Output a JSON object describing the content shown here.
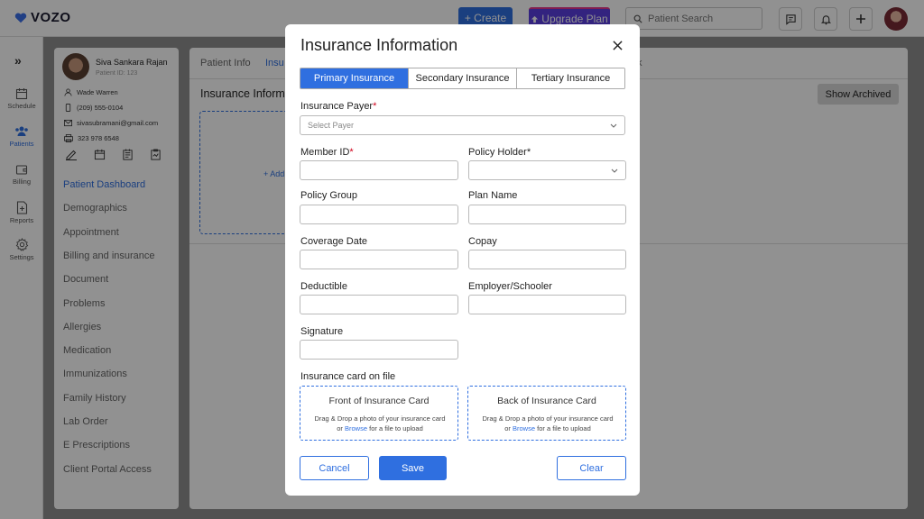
{
  "app": {
    "logo_text": "VOZO",
    "create_label": "+ Create",
    "upgrade_label": "Upgrade Plan",
    "search_placeholder": "Patient Search"
  },
  "nav": {
    "items": [
      {
        "label": "Schedule"
      },
      {
        "label": "Patients"
      },
      {
        "label": "Billing"
      },
      {
        "label": "Reports"
      },
      {
        "label": "Settings"
      }
    ]
  },
  "patient": {
    "name": "Siva Sankara Rajan",
    "id_label": "Patient ID:",
    "id_value": "123",
    "contact_name": "Wade Warren",
    "phone": "(209) 555-0104",
    "email": "sivasubramani@gmail.com",
    "fax": "323 978 6548"
  },
  "patient_menu": [
    "Patient Dashboard",
    "Demographics",
    "Appointment",
    "Billing and insurance",
    "Document",
    "Problems",
    "Allergies",
    "Medication",
    "Immunizations",
    "Family History",
    "Lab Order",
    "E Prescriptions",
    "Client Portal Access"
  ],
  "main": {
    "tabs": [
      "Patient Info",
      "Insu",
      "k"
    ],
    "heading": "Insurance Inform",
    "show_archived": "Show Archived",
    "add_card": "+ Add"
  },
  "modal": {
    "title": "Insurance Information",
    "tabs": [
      "Primary Insurance",
      "Secondary Insurance",
      "Tertiary Insurance"
    ],
    "active_tab": "Primary Insurance",
    "fields": {
      "insurance_payer": {
        "label": "Insurance Payer",
        "placeholder": "Select Payer"
      },
      "member_id": {
        "label": "Member ID",
        "value": ""
      },
      "policy_holder": {
        "label": "Policy Holder",
        "value": ""
      },
      "policy_group": {
        "label": "Policy Group",
        "value": ""
      },
      "plan_name": {
        "label": "Plan Name",
        "value": ""
      },
      "coverage_date": {
        "label": "Coverage Date",
        "value": ""
      },
      "copay": {
        "label": "Copay",
        "value": ""
      },
      "deductible": {
        "label": "Deductible",
        "value": ""
      },
      "employer": {
        "label": "Employer/Schooler",
        "value": ""
      },
      "signature": {
        "label": "Signature",
        "value": ""
      }
    },
    "required_mark": "*",
    "card_section_label": "Insurance card on file",
    "front_card": {
      "title": "Front of Insurance Card",
      "desc_before": "Drag & Drop a photo of your insurance card  or ",
      "browse": "Browse",
      "desc_after": " for a file to upload"
    },
    "back_card": {
      "title": "Back of Insurance Card",
      "desc_before": "Drag & Drop a photo of your insurance card  or ",
      "browse": "Browse",
      "desc_after": " for a file to upload"
    },
    "buttons": {
      "cancel": "Cancel",
      "save": "Save",
      "clear": "Clear"
    }
  },
  "colors": {
    "accent": "#2f6fe0",
    "upgrade": "#5b3fe0",
    "required": "#d0021b"
  }
}
